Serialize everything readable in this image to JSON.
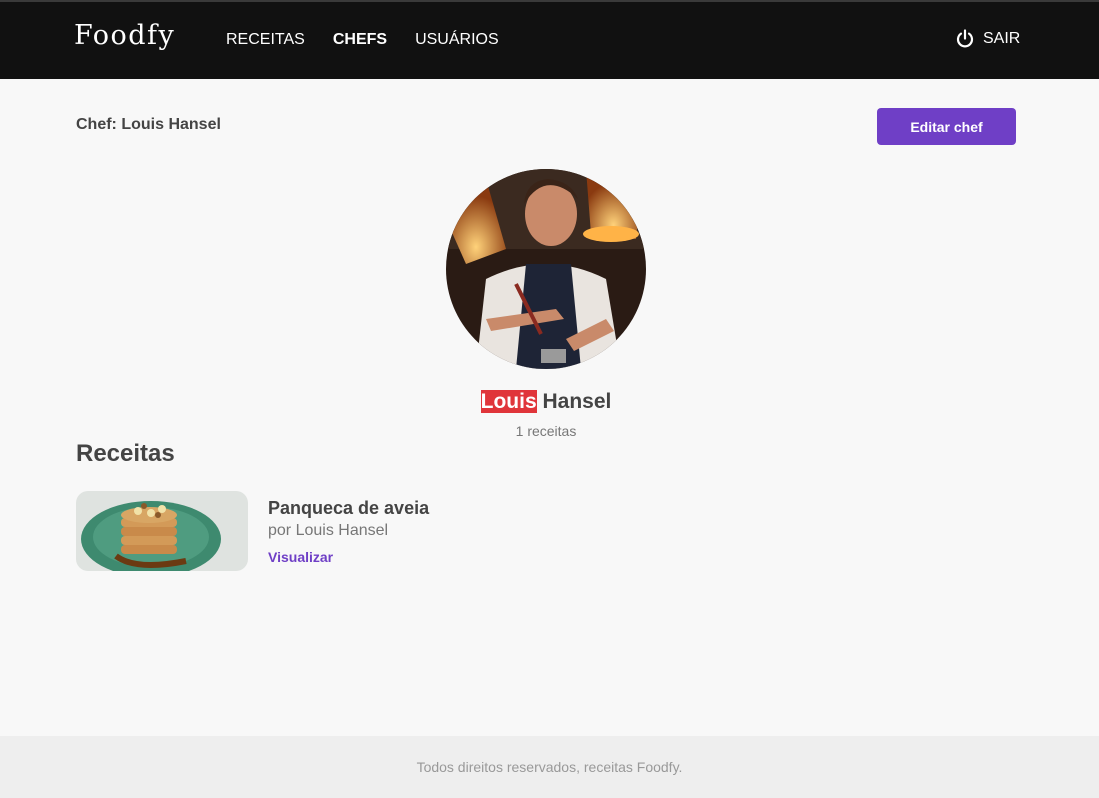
{
  "header": {
    "logo": "Foodfy",
    "nav": [
      {
        "label": "RECEITAS",
        "active": false
      },
      {
        "label": "CHEFS",
        "active": true
      },
      {
        "label": "USUÁRIOS",
        "active": false
      }
    ],
    "logout_label": "SAIR",
    "logout_icon": "power-icon"
  },
  "page": {
    "title": "Chef: Louis Hansel",
    "edit_button": "Editar chef"
  },
  "chef": {
    "first_name": "Louis",
    "last_name": "Hansel",
    "recipe_count": "1 receitas",
    "highlight_color": "#e0353a"
  },
  "recipes": {
    "section_title": "Receitas",
    "items": [
      {
        "title": "Panqueca de aveia",
        "author": "por Louis Hansel",
        "link": "Visualizar"
      }
    ]
  },
  "footer": {
    "text": "Todos direitos reservados, receitas Foodfy."
  },
  "colors": {
    "accent": "#6f3fc6",
    "topbar": "#111111"
  }
}
